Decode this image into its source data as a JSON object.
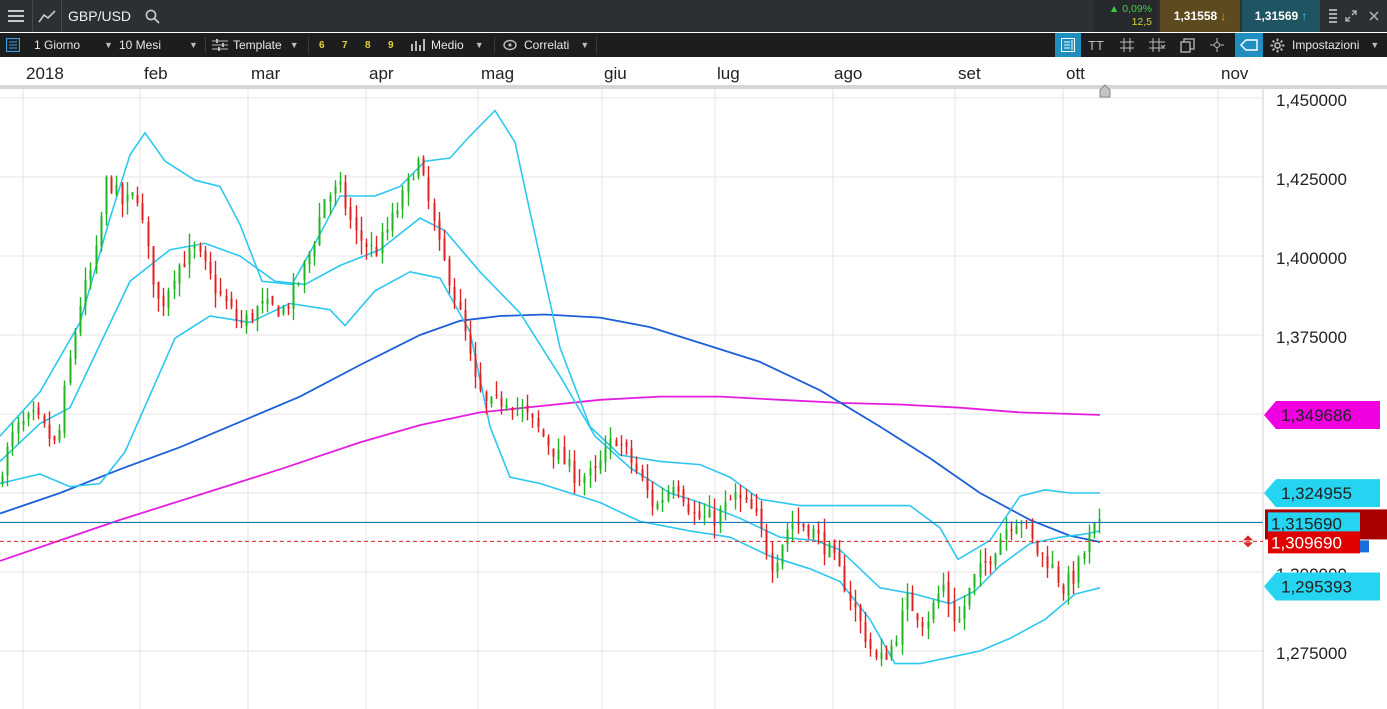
{
  "topbar": {
    "symbol": "GBP/USD",
    "change_pct": "▲ 0,09%",
    "change_pts": "12,5",
    "bid": "1,31558",
    "ask": "1,31569"
  },
  "toolbar": {
    "timeframe": "1 Giorno",
    "range": "10 Mesi",
    "template": "Template",
    "template_numbers": [
      "6",
      "7",
      "8",
      "9"
    ],
    "averages": "Medio",
    "correlated": "Correlati",
    "settings": "Impostazioni",
    "text_tool": "TT"
  },
  "months": [
    "2018",
    "feb",
    "mar",
    "apr",
    "mag",
    "giu",
    "lug",
    "ago",
    "set",
    "ott",
    "nov"
  ],
  "chart_data": {
    "type": "candlestick",
    "y_ticks": [
      "1,450000",
      "1,425000",
      "1,400000",
      "1,375000",
      "1,300000",
      "1,275000"
    ],
    "ylim": [
      1.2665,
      1.453
    ],
    "overlays": [
      {
        "name": "SMA 200",
        "color": "#e41ee0"
      },
      {
        "name": "SMA 100",
        "color": "#1c5fd9"
      },
      {
        "name": "Bollinger",
        "color": "#2dc8f0"
      }
    ],
    "current_bid": 1.31569,
    "crosshair_price": 1.30969,
    "price_tags": [
      {
        "value": "1,349686",
        "bg": "#f000e0",
        "fg": "#222222",
        "price": 1.349686
      },
      {
        "value": "1,324955",
        "bg": "#24d4f0",
        "fg": "#222222",
        "price": 1.324955
      },
      {
        "value": "1,315690",
        "bg": "#24d4f0",
        "fg": "#222222",
        "price": 1.31569
      },
      {
        "value": "1,309690",
        "bg": "#e00000",
        "fg": "#ffffff",
        "price": 1.30969
      },
      {
        "value": "1,295393",
        "bg": "#24d4f0",
        "fg": "#222222",
        "price": 1.295393
      }
    ],
    "colors": {
      "up": "#22b422",
      "down": "#e02222",
      "grid": "#e4e4e4"
    }
  }
}
